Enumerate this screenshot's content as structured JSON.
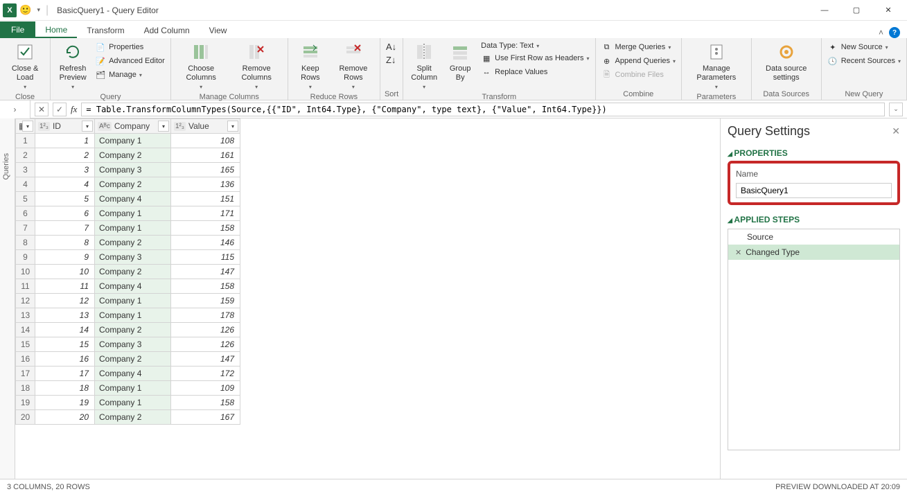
{
  "window": {
    "title": "BasicQuery1 - Query Editor"
  },
  "tabs": {
    "file": "File",
    "home": "Home",
    "transform": "Transform",
    "addcol": "Add Column",
    "view": "View"
  },
  "ribbon": {
    "close": {
      "close_load": "Close &\nLoad",
      "group": "Close"
    },
    "query": {
      "refresh": "Refresh\nPreview",
      "properties": "Properties",
      "advanced": "Advanced Editor",
      "manage": "Manage",
      "group": "Query"
    },
    "mc": {
      "choose": "Choose\nColumns",
      "remove": "Remove\nColumns",
      "group": "Manage Columns"
    },
    "rr": {
      "keep": "Keep\nRows",
      "remove": "Remove\nRows",
      "group": "Reduce Rows"
    },
    "sort": {
      "group": "Sort"
    },
    "tr": {
      "split": "Split\nColumn",
      "groupby": "Group\nBy",
      "datatype": "Data Type: Text",
      "firstrow": "Use First Row as Headers",
      "replace": "Replace Values",
      "group": "Transform"
    },
    "combine": {
      "merge": "Merge Queries",
      "append": "Append Queries",
      "combinefiles": "Combine Files",
      "group": "Combine"
    },
    "params": {
      "manage": "Manage\nParameters",
      "group": "Parameters"
    },
    "ds": {
      "settings": "Data source\nsettings",
      "group": "Data Sources"
    },
    "nq": {
      "new": "New Source",
      "recent": "Recent Sources",
      "group": "New Query"
    }
  },
  "formula": "= Table.TransformColumnTypes(Source,{{\"ID\", Int64.Type}, {\"Company\", type text}, {\"Value\", Int64.Type}})",
  "queries_label": "Queries",
  "columns": [
    {
      "name": "ID",
      "type": "123"
    },
    {
      "name": "Company",
      "type": "ABC"
    },
    {
      "name": "Value",
      "type": "123"
    }
  ],
  "rows": [
    {
      "n": 1,
      "id": 1,
      "company": "Company 1",
      "value": 108
    },
    {
      "n": 2,
      "id": 2,
      "company": "Company 2",
      "value": 161
    },
    {
      "n": 3,
      "id": 3,
      "company": "Company 3",
      "value": 165
    },
    {
      "n": 4,
      "id": 4,
      "company": "Company 2",
      "value": 136
    },
    {
      "n": 5,
      "id": 5,
      "company": "Company 4",
      "value": 151
    },
    {
      "n": 6,
      "id": 6,
      "company": "Company 1",
      "value": 171
    },
    {
      "n": 7,
      "id": 7,
      "company": "Company 1",
      "value": 158
    },
    {
      "n": 8,
      "id": 8,
      "company": "Company 2",
      "value": 146
    },
    {
      "n": 9,
      "id": 9,
      "company": "Company 3",
      "value": 115
    },
    {
      "n": 10,
      "id": 10,
      "company": "Company 2",
      "value": 147
    },
    {
      "n": 11,
      "id": 11,
      "company": "Company 4",
      "value": 158
    },
    {
      "n": 12,
      "id": 12,
      "company": "Company 1",
      "value": 159
    },
    {
      "n": 13,
      "id": 13,
      "company": "Company 1",
      "value": 178
    },
    {
      "n": 14,
      "id": 14,
      "company": "Company 2",
      "value": 126
    },
    {
      "n": 15,
      "id": 15,
      "company": "Company 3",
      "value": 126
    },
    {
      "n": 16,
      "id": 16,
      "company": "Company 2",
      "value": 147
    },
    {
      "n": 17,
      "id": 17,
      "company": "Company 4",
      "value": 172
    },
    {
      "n": 18,
      "id": 18,
      "company": "Company 1",
      "value": 109
    },
    {
      "n": 19,
      "id": 19,
      "company": "Company 1",
      "value": 158
    },
    {
      "n": 20,
      "id": 20,
      "company": "Company 2",
      "value": 167
    }
  ],
  "settings": {
    "title": "Query Settings",
    "properties": "PROPERTIES",
    "name_label": "Name",
    "name_value": "BasicQuery1",
    "applied": "APPLIED STEPS",
    "steps": [
      {
        "label": "Source",
        "sel": false
      },
      {
        "label": "Changed Type",
        "sel": true
      }
    ]
  },
  "status": {
    "left": "3 COLUMNS, 20 ROWS",
    "right": "PREVIEW DOWNLOADED AT 20:09"
  }
}
